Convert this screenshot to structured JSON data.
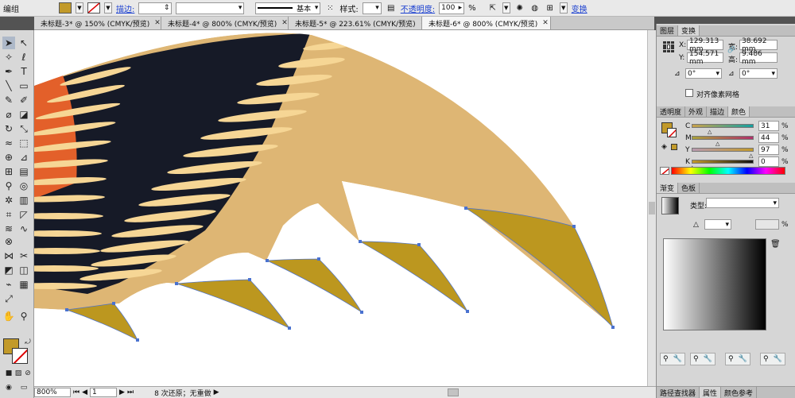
{
  "control_bar": {
    "mode_label": "编组",
    "fill_color": "#c29a2a",
    "stroke_label": "描边:",
    "stroke_width_value": "",
    "brush_label": "基本",
    "style_label": "样式:",
    "opacity_label": "不透明度:",
    "opacity_value": "100",
    "opacity_unit": "%",
    "transform_label": "变换"
  },
  "tabs": [
    {
      "label": "未标题-3* @ 150% (CMYK/预览)",
      "active": false
    },
    {
      "label": "未标题-4* @ 800% (CMYK/预览)",
      "active": false
    },
    {
      "label": "未标题-5* @ 223.61% (CMYK/预览)",
      "active": false
    },
    {
      "label": "未标题-6* @ 800% (CMYK/预览)",
      "active": true
    }
  ],
  "status_bar": {
    "zoom": "800%",
    "artboard": "1",
    "history": "8 次还原；无重做"
  },
  "transform_panel": {
    "tabs": [
      "图层",
      "变换"
    ],
    "x_label": "X:",
    "x_value": "129.313 mm",
    "y_label": "Y:",
    "y_value": "154.571 mm",
    "w_label": "宽:",
    "w_value": "38.692 mm",
    "h_label": "高:",
    "h_value": "9.486 mm",
    "angle_value": "0°",
    "shear_value": "0°",
    "align_pixel_label": "对齐像素网格"
  },
  "color_panel": {
    "tabs": [
      "透明度",
      "外观",
      "描边",
      "颜色"
    ],
    "fill_color": "#c29a2a",
    "channels": [
      {
        "label": "C",
        "value": "31",
        "level": 0.31,
        "gradient": "linear-gradient(to right,#c9a14a,#14a0a0)"
      },
      {
        "label": "M",
        "value": "44",
        "level": 0.44,
        "gradient": "linear-gradient(to right,#a8a23a,#b0306a)"
      },
      {
        "label": "Y",
        "value": "97",
        "level": 0.97,
        "gradient": "linear-gradient(to right,#b89ab0,#c29a2a)"
      },
      {
        "label": "K",
        "value": "0",
        "level": 0.0,
        "gradient": "linear-gradient(to right,#c29a2a,#111111)"
      }
    ],
    "unit": "%"
  },
  "gradient_panel": {
    "tabs": [
      "渐变",
      "色板"
    ],
    "type_label": "类型:",
    "angle_label": "△",
    "opacity_unit": "%"
  },
  "dock_tabs": [
    "路径查找器",
    "属性",
    "颜色参考"
  ],
  "artwork_colors": {
    "tan": "#deb674",
    "navy": "#161a27",
    "cream": "#f6d695",
    "orange": "#e3602a",
    "gold": "#bc971f",
    "anchor": "#4a72d0"
  }
}
